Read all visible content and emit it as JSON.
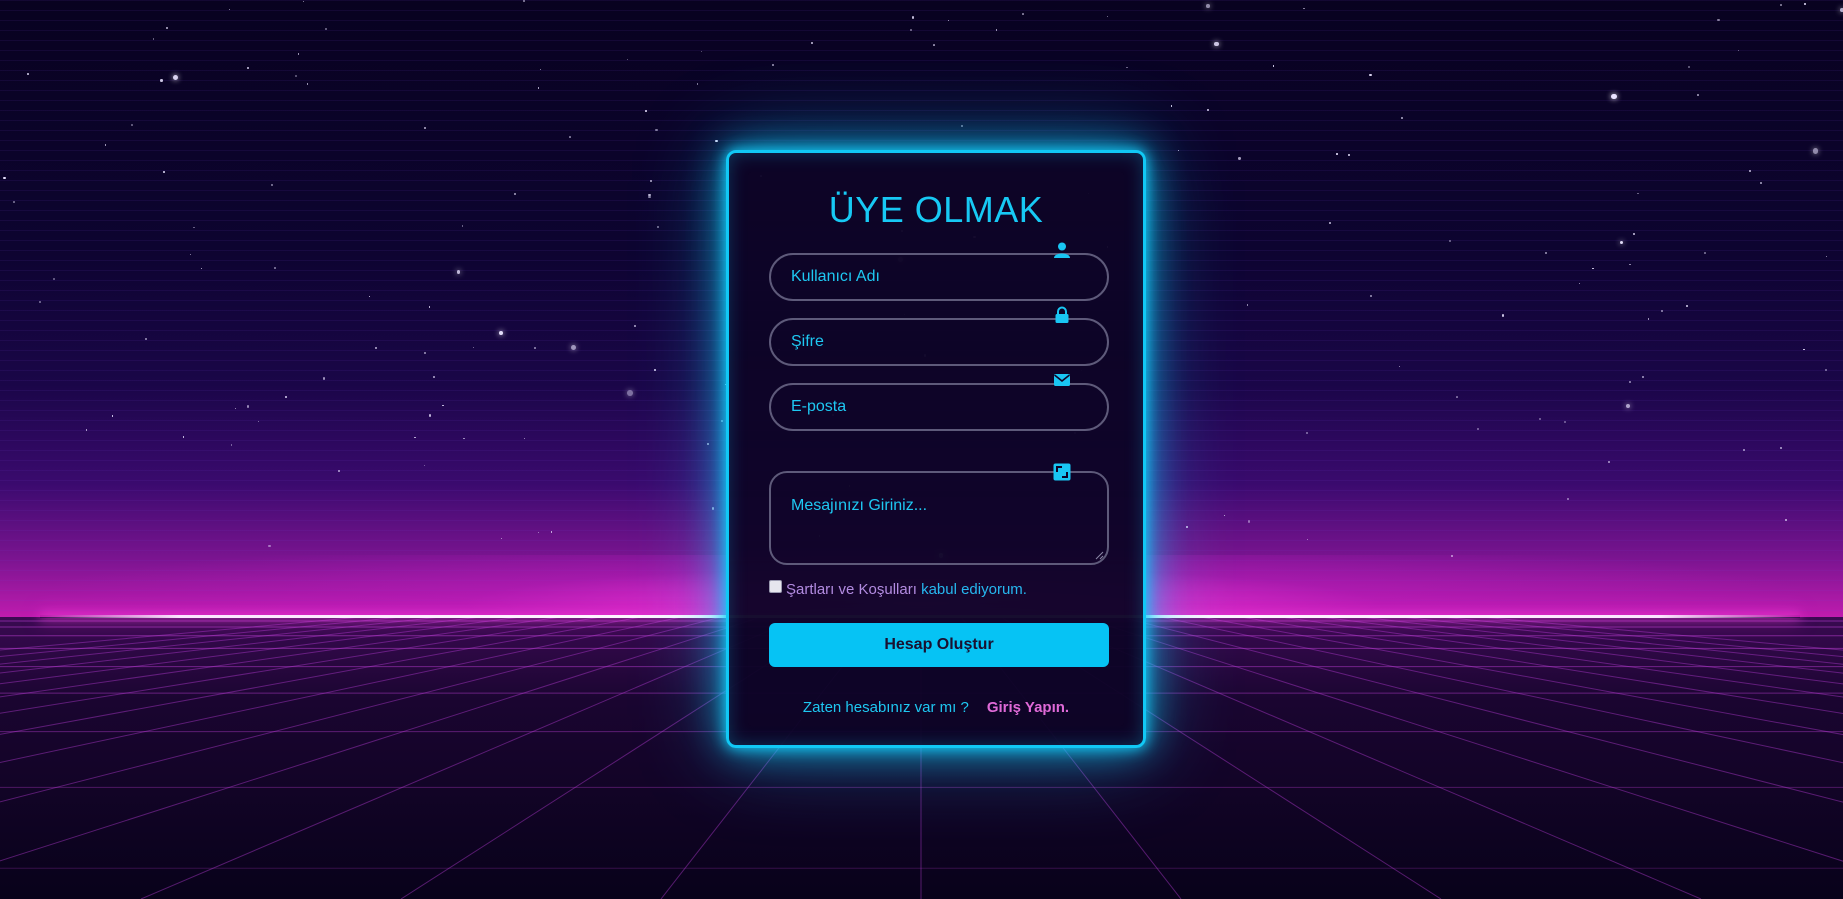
{
  "form": {
    "title": "ÜYE OLMAK",
    "fields": [
      {
        "placeholder": "Kullanıcı Adı",
        "icon": "user-icon"
      },
      {
        "placeholder": "Şifre",
        "icon": "lock-icon"
      },
      {
        "placeholder": "E-posta",
        "icon": "envelope-icon"
      }
    ],
    "message": {
      "placeholder": "Mesajınızı Giriniz...",
      "icon": "expand-icon"
    },
    "terms": {
      "text": "Şartları ve Koşulları ",
      "link": "kabul ediyorum."
    },
    "submit_label": "Hesap Oluştur",
    "footer": {
      "question": "Zaten hesabınız var mı ?",
      "login_link": "Giriş Yapın."
    }
  },
  "colors": {
    "accent": "#06c3f4",
    "link_pink": "#e06ad8",
    "card_bg": "#0e0426"
  }
}
